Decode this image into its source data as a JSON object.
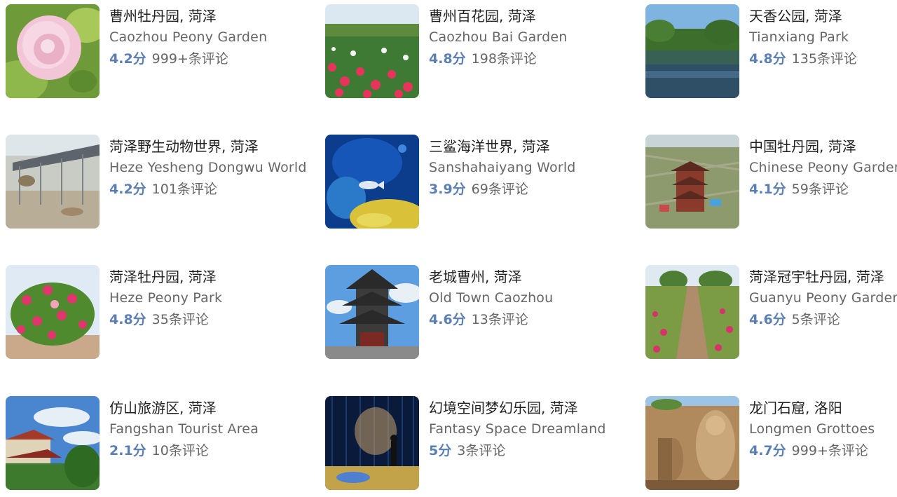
{
  "colors": {
    "score": "#5b7fb3",
    "name": "#1f1f1f",
    "secondary": "#666666"
  },
  "places": [
    {
      "name": "曹州牡丹园, 菏泽",
      "english": "Caozhou Peony Garden",
      "score": "4.2分",
      "reviews": "999+条评论",
      "image": "pink-peony-closeup-photo"
    },
    {
      "name": "曹州百花园, 菏泽",
      "english": "Caozhou Bai Garden",
      "score": "4.8分",
      "reviews": "198条评论",
      "image": "flower-field-photo"
    },
    {
      "name": "天香公园, 菏泽",
      "english": "Tianxiang Park",
      "score": "4.8分",
      "reviews": "135条评论",
      "image": "lake-trees-photo"
    },
    {
      "name": "菏泽野生动物世界, 菏泽",
      "english": "Heze Yesheng Dongwu World",
      "score": "4.2分",
      "reviews": "101条评论",
      "image": "wildlife-enclosure-photo"
    },
    {
      "name": "三鲨海洋世界, 菏泽",
      "english": "Sanshahaiyang World",
      "score": "3.9分",
      "reviews": "69条评论",
      "image": "aquarium-coral-photo"
    },
    {
      "name": "中国牡丹园, 菏泽",
      "english": "Chinese Peony Garden",
      "score": "4.1分",
      "reviews": "59条评论",
      "image": "aerial-pagoda-photo"
    },
    {
      "name": "菏泽牡丹园, 菏泽",
      "english": "Heze Peony Park",
      "score": "4.8分",
      "reviews": "35条评论",
      "image": "peony-bush-photo"
    },
    {
      "name": "老城曹州, 菏泽",
      "english": "Old Town Caozhou",
      "score": "4.6分",
      "reviews": "13条评论",
      "image": "pagoda-tower-photo"
    },
    {
      "name": "菏泽冠宇牡丹园, 菏泽",
      "english": "Guanyu Peony Garden",
      "score": "4.6分",
      "reviews": "5条评论",
      "image": "peony-rows-photo"
    },
    {
      "name": "仿山旅游区, 菏泽",
      "english": "Fangshan Tourist Area",
      "score": "2.1分",
      "reviews": "10条评论",
      "image": "temple-roof-photo"
    },
    {
      "name": "幻境空间梦幻乐园, 菏泽",
      "english": "Fantasy Space Dreamland",
      "score": "5分",
      "reviews": "3条评论",
      "image": "light-installation-photo"
    },
    {
      "name": "龙门石窟, 洛阳",
      "english": "Longmen Grottoes",
      "score": "4.7分",
      "reviews": "999+条评论",
      "image": "stone-buddha-photo"
    }
  ]
}
